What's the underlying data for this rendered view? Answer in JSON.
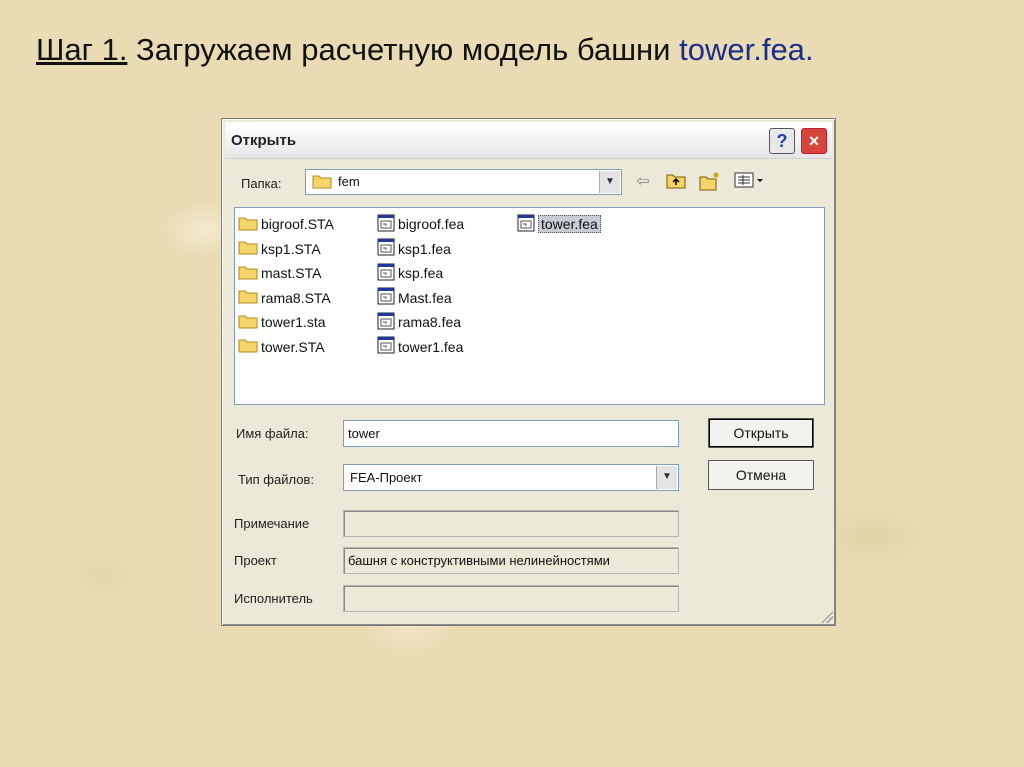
{
  "slide": {
    "step": "Шаг 1.",
    "text": " Загружаем расчетную модель башни ",
    "file": "tower.fea",
    "period": "."
  },
  "dialog": {
    "title": "Открыть",
    "help_label": "?",
    "close_label": "×",
    "folder_label": "Папка:",
    "folder_value": "fem",
    "filename_label": "Имя файла:",
    "filename_value": "tower",
    "filetype_label": "Тип файлов:",
    "filetype_value": "FEA-Проект",
    "note_label": "Примечание",
    "note_value": "",
    "project_label": "Проект",
    "project_value": "башня с конструктивными нелинейностями",
    "author_label": "Исполнитель",
    "author_value": "",
    "open_button": "Открыть",
    "cancel_button": "Отмена",
    "files": {
      "folders": [
        "bigroof.STA",
        "ksp1.STA",
        "mast.STA",
        "rama8.STA",
        "tower1.sta",
        "tower.STA"
      ],
      "fea_col1": [
        "bigroof.fea",
        "ksp1.fea",
        "ksp.fea",
        "Mast.fea",
        "rama8.fea",
        "tower1.fea"
      ],
      "fea_col2": [
        "tower.fea"
      ]
    },
    "selected_file": "tower.fea",
    "icons": {
      "back": "back-arrow-icon",
      "up": "up-folder-icon",
      "new_folder": "new-folder-icon",
      "view": "view-menu-icon"
    },
    "colors": {
      "close_button": "#d8433a",
      "selection": "#c8ccd4",
      "title_file": "#1c2e8c"
    }
  }
}
